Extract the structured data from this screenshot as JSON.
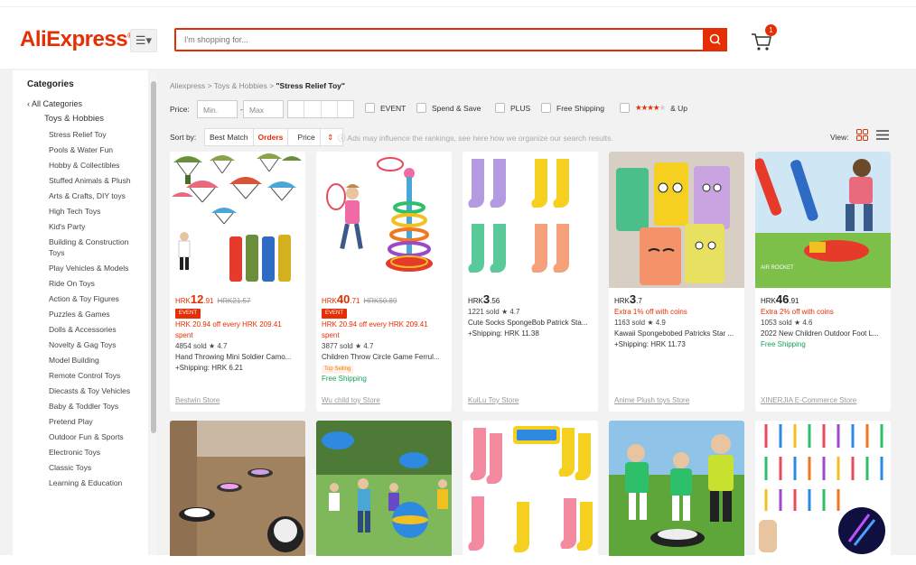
{
  "header": {
    "logo": "AliExpress",
    "search_placeholder": "I'm shopping for...",
    "cart_count": "1"
  },
  "sidebar": {
    "title": "Categories",
    "all": "All Categories",
    "current": "Toys & Hobbies",
    "items": [
      "Stress Relief Toy",
      "Pools & Water Fun",
      "Hobby & Collectibles",
      "Stuffed Animals & Plush",
      "Arts & Crafts, DIY toys",
      "High Tech Toys",
      "Kid's Party",
      "Building & Construction Toys",
      "Play Vehicles & Models",
      "Ride On Toys",
      "Action & Toy Figures",
      "Puzzles & Games",
      "Dolls & Accessories",
      "Novelty & Gag Toys",
      "Model Building",
      "Remote Control Toys",
      "Diecasts & Toy Vehicles",
      "Baby & Toddler Toys",
      "Pretend Play",
      "Outdoor Fun & Sports",
      "Electronic Toys",
      "Classic Toys",
      "Learning & Education"
    ]
  },
  "breadcrumb": {
    "root": "Aliexpress",
    "cat": "Toys & Hobbies",
    "query": "\"Stress Relief Toy\""
  },
  "filters": {
    "price_label": "Price:",
    "min": "Min.",
    "dash": "-",
    "max": "Max",
    "event": "EVENT",
    "spend": "Spend & Save",
    "plus": "PLUS",
    "free": "Free Shipping",
    "up": "& Up"
  },
  "sort": {
    "label": "Sort by:",
    "best": "Best Match",
    "orders": "Orders",
    "price": "Price",
    "ads_note": "Ads may influence the rankings, see here how we organize our search results.",
    "view": "View:"
  },
  "products": [
    {
      "currency": "HRK",
      "int": "12",
      "dec": ".91",
      "old": "HRK21.57",
      "red": true,
      "event": "EVENT",
      "promo": "HRK 20.94 off every HRK 209.41 spent",
      "sold": "4854 sold",
      "rating": "4.7",
      "title": "Hand Throwing Mini Soldier Camo...",
      "ship": "+Shipping: HRK 6.21",
      "store": "Bestwin Store"
    },
    {
      "currency": "HRK",
      "int": "40",
      "dec": ".71",
      "old": "HRK50.89",
      "red": true,
      "event": "EVENT",
      "promo": "HRK 20.94 off every HRK 209.41 spent",
      "sold": "3877 sold",
      "rating": "4.7",
      "title": "Children Throw Circle Game Ferrul...",
      "badge": "Top Selling",
      "ship": "Free Shipping",
      "store": "Wu child toy Store"
    },
    {
      "currency": "HRK",
      "int": "3",
      "dec": ".56",
      "sold": "1221 sold",
      "rating": "4.7",
      "title": "Cute Socks SpongeBob Patrick Sta...",
      "ship": "+Shipping: HRK 11.38",
      "store": "KuiLu Toy Store"
    },
    {
      "currency": "HRK",
      "int": "3",
      "dec": ".7",
      "promo": "Extra 1% off with coins",
      "sold": "1163 sold",
      "rating": "4.9",
      "title": "Kawaii Spongebobed Patricks Star ...",
      "ship": "+Shipping: HRK 11.73",
      "store": "Anime Plush toys Store"
    },
    {
      "currency": "HRK",
      "int": "46",
      "dec": ".91",
      "promo": "Extra 2% off with coins",
      "sold": "1053 sold",
      "rating": "4.6",
      "title": "2022 New Children Outdoor Foot L...",
      "ship": "Free Shipping",
      "store": "XINERJIA E-Commerce Store",
      "img_text": "AIR ROCKET"
    }
  ],
  "colors": {
    "accent": "#e62e04",
    "free": "#14a058"
  }
}
